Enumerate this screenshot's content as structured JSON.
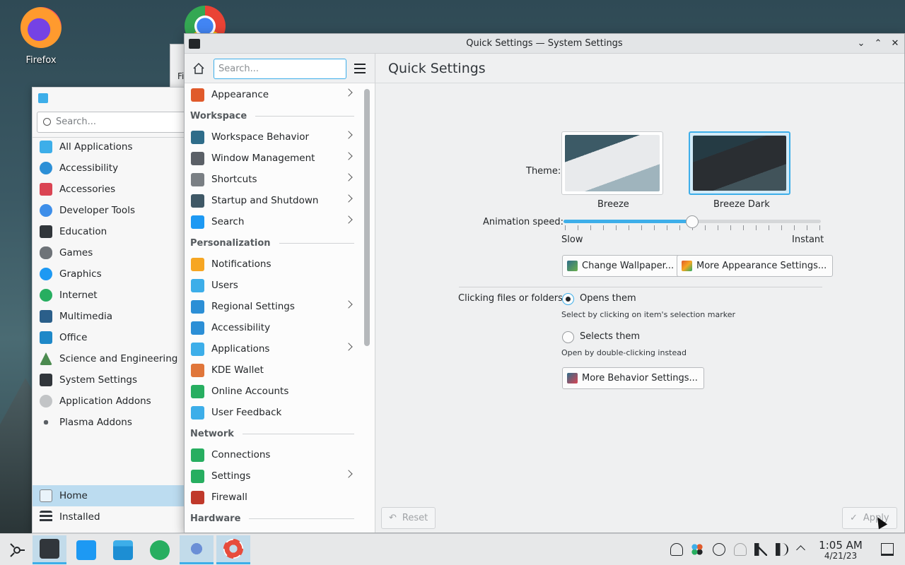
{
  "desktop": {
    "icons": [
      {
        "label": "Firefox"
      },
      {
        "label": ""
      }
    ],
    "bg_window_label": "Fi"
  },
  "launcher": {
    "search_placeholder": "Search...",
    "categories": [
      {
        "label": "All Applications",
        "color": "#3daee9"
      },
      {
        "label": "Accessibility",
        "color": "#2c8fd6"
      },
      {
        "label": "Accessories",
        "color": "#da4453"
      },
      {
        "label": "Developer Tools",
        "color": "#3d8ee9"
      },
      {
        "label": "Education",
        "color": "#31363b"
      },
      {
        "label": "Games",
        "color": "#6e7378"
      },
      {
        "label": "Graphics",
        "color": "#1d99f3"
      },
      {
        "label": "Internet",
        "color": "#27ae60"
      },
      {
        "label": "Multimedia",
        "color": "#2b5f8a"
      },
      {
        "label": "Office",
        "color": "#1e88c8"
      },
      {
        "label": "Science and Engineering",
        "color": "#4b8a4f"
      },
      {
        "label": "System Settings",
        "color": "#31363b"
      },
      {
        "label": "Application Addons",
        "color": "#c2c4c6"
      },
      {
        "label": "Plasma Addons",
        "color": "#5a5f64"
      }
    ],
    "footer": [
      {
        "label": "Home",
        "selected": true
      },
      {
        "label": "Installed",
        "selected": false
      }
    ]
  },
  "window": {
    "title": "Quick Settings — System Settings",
    "search_placeholder": "Search...",
    "controls": {
      "minimize": "⌄",
      "maximize": "⌃",
      "close": "✕"
    }
  },
  "sidebar": {
    "items": [
      {
        "type": "item",
        "label": "Appearance",
        "chevron": true,
        "color": "#e05a2b"
      },
      {
        "type": "section",
        "label": "Workspace"
      },
      {
        "type": "item",
        "label": "Workspace Behavior",
        "chevron": true,
        "color": "#2f6d8a"
      },
      {
        "type": "item",
        "label": "Window Management",
        "chevron": true,
        "color": "#5b6067"
      },
      {
        "type": "item",
        "label": "Shortcuts",
        "chevron": true,
        "color": "#7a7f84"
      },
      {
        "type": "item",
        "label": "Startup and Shutdown",
        "chevron": true,
        "color": "#3f5866"
      },
      {
        "type": "item",
        "label": "Search",
        "chevron": true,
        "color": "#1d99f3"
      },
      {
        "type": "section",
        "label": "Personalization"
      },
      {
        "type": "item",
        "label": "Notifications",
        "chevron": false,
        "color": "#f6a623"
      },
      {
        "type": "item",
        "label": "Users",
        "chevron": false,
        "color": "#3daee9"
      },
      {
        "type": "item",
        "label": "Regional Settings",
        "chevron": true,
        "color": "#2c8fd6"
      },
      {
        "type": "item",
        "label": "Accessibility",
        "chevron": false,
        "color": "#2c8fd6"
      },
      {
        "type": "item",
        "label": "Applications",
        "chevron": true,
        "color": "#3daee9"
      },
      {
        "type": "item",
        "label": "KDE Wallet",
        "chevron": false,
        "color": "#e0763a"
      },
      {
        "type": "item",
        "label": "Online Accounts",
        "chevron": false,
        "color": "#27ae60"
      },
      {
        "type": "item",
        "label": "User Feedback",
        "chevron": false,
        "color": "#3daee9"
      },
      {
        "type": "section",
        "label": "Network"
      },
      {
        "type": "item",
        "label": "Connections",
        "chevron": false,
        "color": "#27ae60"
      },
      {
        "type": "item",
        "label": "Settings",
        "chevron": true,
        "color": "#27ae60"
      },
      {
        "type": "item",
        "label": "Firewall",
        "chevron": false,
        "color": "#c0392b"
      },
      {
        "type": "section",
        "label": "Hardware"
      }
    ]
  },
  "content": {
    "page_title": "Quick Settings",
    "theme_label": "Theme:",
    "themes": [
      {
        "label": "Breeze",
        "selected": false
      },
      {
        "label": "Breeze Dark",
        "selected": true
      }
    ],
    "animation_label": "Animation speed:",
    "animation_value": 0.5,
    "slider_min_label": "Slow",
    "slider_max_label": "Instant",
    "change_wallpaper": "Change Wallpaper...",
    "more_appearance": "More Appearance Settings...",
    "clicking_label": "Clicking files or folders:",
    "opt_open": "Opens them",
    "opt_open_hint": "Select by clicking on item's selection marker",
    "opt_select": "Selects them",
    "opt_select_hint": "Open by double-clicking instead",
    "selected_option": "open",
    "more_behavior": "More Behavior Settings...",
    "reset": "Reset",
    "apply": "Apply"
  },
  "taskbar": {
    "time": "1:05 AM",
    "date": "4/21/23"
  },
  "colors": {
    "accent": "#3daee9"
  }
}
